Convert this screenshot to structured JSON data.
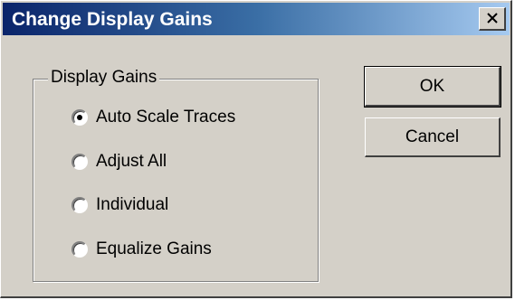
{
  "window": {
    "title": "Change Display Gains",
    "close_icon": "close-icon"
  },
  "group": {
    "label": "Display Gains",
    "options": [
      {
        "label": "Auto Scale Traces",
        "selected": true
      },
      {
        "label": "Adjust All",
        "selected": false
      },
      {
        "label": "Individual",
        "selected": false
      },
      {
        "label": "Equalize Gains",
        "selected": false
      }
    ]
  },
  "buttons": {
    "ok_label": "OK",
    "cancel_label": "Cancel"
  },
  "colors": {
    "titlebar_start": "#0a246a",
    "titlebar_end": "#a6caf0",
    "face": "#d4d0c8"
  }
}
